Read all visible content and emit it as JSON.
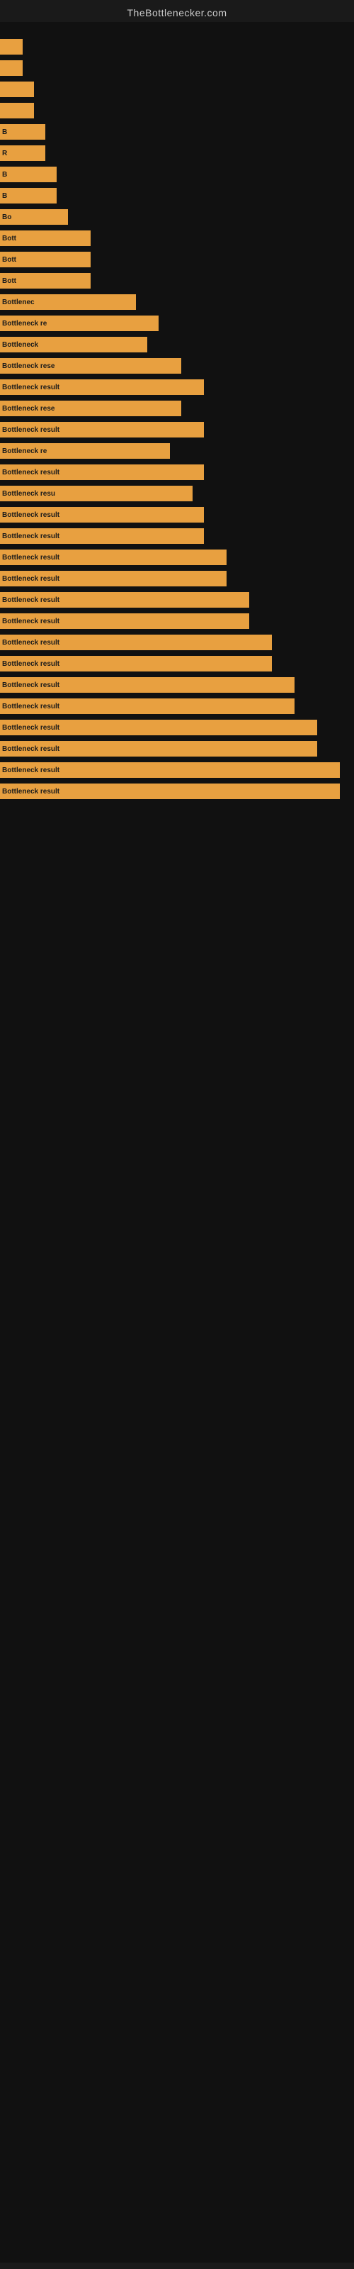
{
  "site": {
    "title": "TheBottlenecker.com"
  },
  "bars": [
    {
      "label": "",
      "width": 2,
      "text": ""
    },
    {
      "label": "",
      "width": 2,
      "text": ""
    },
    {
      "label": "",
      "width": 3,
      "text": ""
    },
    {
      "label": "",
      "width": 3,
      "text": ""
    },
    {
      "label": "",
      "width": 4,
      "text": "B"
    },
    {
      "label": "",
      "width": 4,
      "text": "R"
    },
    {
      "label": "",
      "width": 5,
      "text": "B"
    },
    {
      "label": "",
      "width": 5,
      "text": "B"
    },
    {
      "label": "",
      "width": 6,
      "text": "Bo"
    },
    {
      "label": "",
      "width": 8,
      "text": "Bott"
    },
    {
      "label": "",
      "width": 8,
      "text": "Bott"
    },
    {
      "label": "",
      "width": 8,
      "text": "Bott"
    },
    {
      "label": "",
      "width": 12,
      "text": "Bottlenec"
    },
    {
      "label": "",
      "width": 14,
      "text": "Bottleneck re"
    },
    {
      "label": "",
      "width": 13,
      "text": "Bottleneck"
    },
    {
      "label": "",
      "width": 16,
      "text": "Bottleneck rese"
    },
    {
      "label": "",
      "width": 18,
      "text": "Bottleneck result"
    },
    {
      "label": "",
      "width": 16,
      "text": "Bottleneck rese"
    },
    {
      "label": "",
      "width": 18,
      "text": "Bottleneck result"
    },
    {
      "label": "",
      "width": 15,
      "text": "Bottleneck re"
    },
    {
      "label": "",
      "width": 18,
      "text": "Bottleneck result"
    },
    {
      "label": "",
      "width": 17,
      "text": "Bottleneck resu"
    },
    {
      "label": "",
      "width": 18,
      "text": "Bottleneck result"
    },
    {
      "label": "",
      "width": 18,
      "text": "Bottleneck result"
    },
    {
      "label": "",
      "width": 20,
      "text": "Bottleneck result"
    },
    {
      "label": "",
      "width": 20,
      "text": "Bottleneck result"
    },
    {
      "label": "",
      "width": 22,
      "text": "Bottleneck result"
    },
    {
      "label": "",
      "width": 22,
      "text": "Bottleneck result"
    },
    {
      "label": "",
      "width": 24,
      "text": "Bottleneck result"
    },
    {
      "label": "",
      "width": 24,
      "text": "Bottleneck result"
    },
    {
      "label": "",
      "width": 26,
      "text": "Bottleneck result"
    },
    {
      "label": "",
      "width": 26,
      "text": "Bottleneck result"
    },
    {
      "label": "",
      "width": 28,
      "text": "Bottleneck result"
    },
    {
      "label": "",
      "width": 28,
      "text": "Bottleneck result"
    },
    {
      "label": "",
      "width": 30,
      "text": "Bottleneck result"
    },
    {
      "label": "",
      "width": 30,
      "text": "Bottleneck result"
    }
  ],
  "colors": {
    "background": "#111111",
    "bar": "#e8a040",
    "text": "#cccccc",
    "bar_text": "#1a1a1a"
  }
}
